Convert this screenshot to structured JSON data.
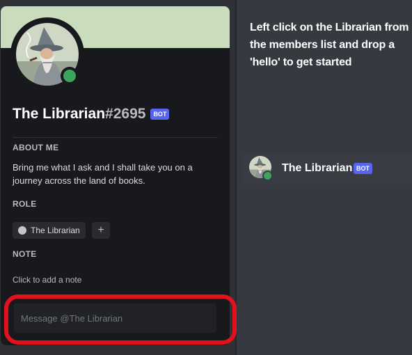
{
  "profile": {
    "name": "The Librarian",
    "discriminator": "#2695",
    "bot_badge": "BOT",
    "about_title": "ABOUT ME",
    "about_text": "Bring me what I ask and I shall take you on a journey across the land of books.",
    "role_title": "ROLE",
    "role_name": "The Librarian",
    "role_add": "+",
    "note_title": "NOTE",
    "note_hint": "Click to add a note",
    "message_placeholder": "Message @The Librarian",
    "status": "online",
    "banner_color": "#c9dcbd",
    "status_color": "#3ba55d"
  },
  "instruction": "Left click on the Librarian from the members list and drop a 'hello' to get started",
  "member": {
    "name": "The Librarian",
    "bot_badge": "BOT"
  },
  "colors": {
    "highlight": "#e3101e",
    "bot_badge": "#5865f2"
  }
}
